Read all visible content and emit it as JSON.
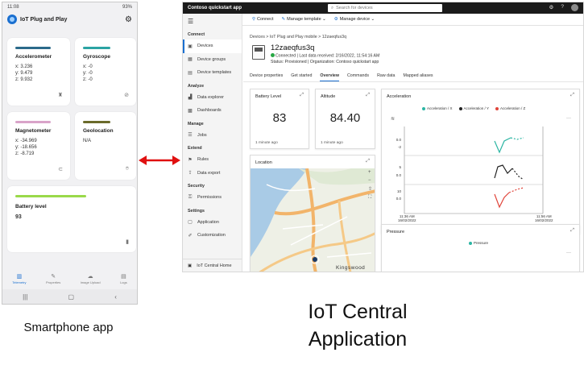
{
  "phone": {
    "status_time": "11:08",
    "status_right": "93%",
    "app_title": "IoT Plug and Play",
    "cards": [
      {
        "title": "Accelerometer",
        "lines": [
          "x: 3.236",
          "y: 9.479",
          "z: 9.932"
        ],
        "color": "#2b6a8a"
      },
      {
        "title": "Gyroscope",
        "lines": [
          "x: -0",
          "y: -0",
          "z: -0"
        ],
        "color": "#2ba3a3"
      },
      {
        "title": "Magnetometer",
        "lines": [
          "x: -34.969",
          "y: -18.656",
          "z: -8.719"
        ],
        "color": "#d9a3c9"
      },
      {
        "title": "Geolocation",
        "lines": [
          "N/A"
        ],
        "color": "#6a6a2a"
      },
      {
        "title": "Battery level",
        "lines": [
          "93"
        ],
        "color": "#9ad94a"
      }
    ],
    "nav": [
      "Telemetry",
      "Properties",
      "Image Upload",
      "Logs"
    ],
    "caption": "Smartphone app"
  },
  "central": {
    "app_name": "Contoso quickstart app",
    "search_placeholder": "Search for devices",
    "cmd": [
      "Connect",
      "Manage template",
      "Manage device"
    ],
    "sidebar": {
      "sections": [
        {
          "label": "Connect",
          "items": [
            "Devices",
            "Device groups",
            "Device templates"
          ]
        },
        {
          "label": "Analyze",
          "items": [
            "Data explorer",
            "Dashboards"
          ]
        },
        {
          "label": "Manage",
          "items": [
            "Jobs"
          ]
        },
        {
          "label": "Extend",
          "items": [
            "Rules",
            "Data export"
          ]
        },
        {
          "label": "Security",
          "items": [
            "Permissions"
          ]
        },
        {
          "label": "Settings",
          "items": [
            "Application",
            "Customization"
          ]
        }
      ],
      "home": "IoT Central Home"
    },
    "breadcrumb": "Devices > IoT Plug and Play mobile > 12zaeqfus3q",
    "device": {
      "name": "12zaeqfus3q",
      "status": "Connected | Last data received: 2/16/2022, 11:54:16 AM",
      "status2": "Status: Provisioned | Organization: Contoso quickstart app"
    },
    "tabs": [
      "Device properties",
      "Get started",
      "Overview",
      "Commands",
      "Raw data",
      "Mapped aliases"
    ],
    "tiles": {
      "battery": {
        "title": "Battery Level",
        "value": "83",
        "ago": "1 minute ago"
      },
      "altitude": {
        "title": "Altitude",
        "value": "84.40",
        "ago": "1 minute ago"
      },
      "location": {
        "title": "Location",
        "place": "Kingswood"
      },
      "acceleration": {
        "title": "Acceleration",
        "legend": [
          "Acceleration / X",
          "Acceleration / Y",
          "Acceleration / Z"
        ],
        "y_ticks_top": [
          "0.0",
          "-2"
        ],
        "y_ticks_mid": [
          "5",
          "0.0"
        ],
        "y_ticks_bot": [
          "10",
          "0.0"
        ],
        "x_left": "11:36 AM",
        "x_left_date": "16/02/2022",
        "x_right": "11:56 AM",
        "x_right_date": "16/02/2022"
      },
      "pressure": {
        "title": "Pressure",
        "legend": [
          "Pressure"
        ]
      }
    },
    "caption": "IoT Central Application"
  },
  "colors": {
    "accent": "#1a6fd0",
    "x": "#2bb5a3",
    "y": "#222222",
    "z": "#e0443a",
    "arrow": "#e01010"
  }
}
